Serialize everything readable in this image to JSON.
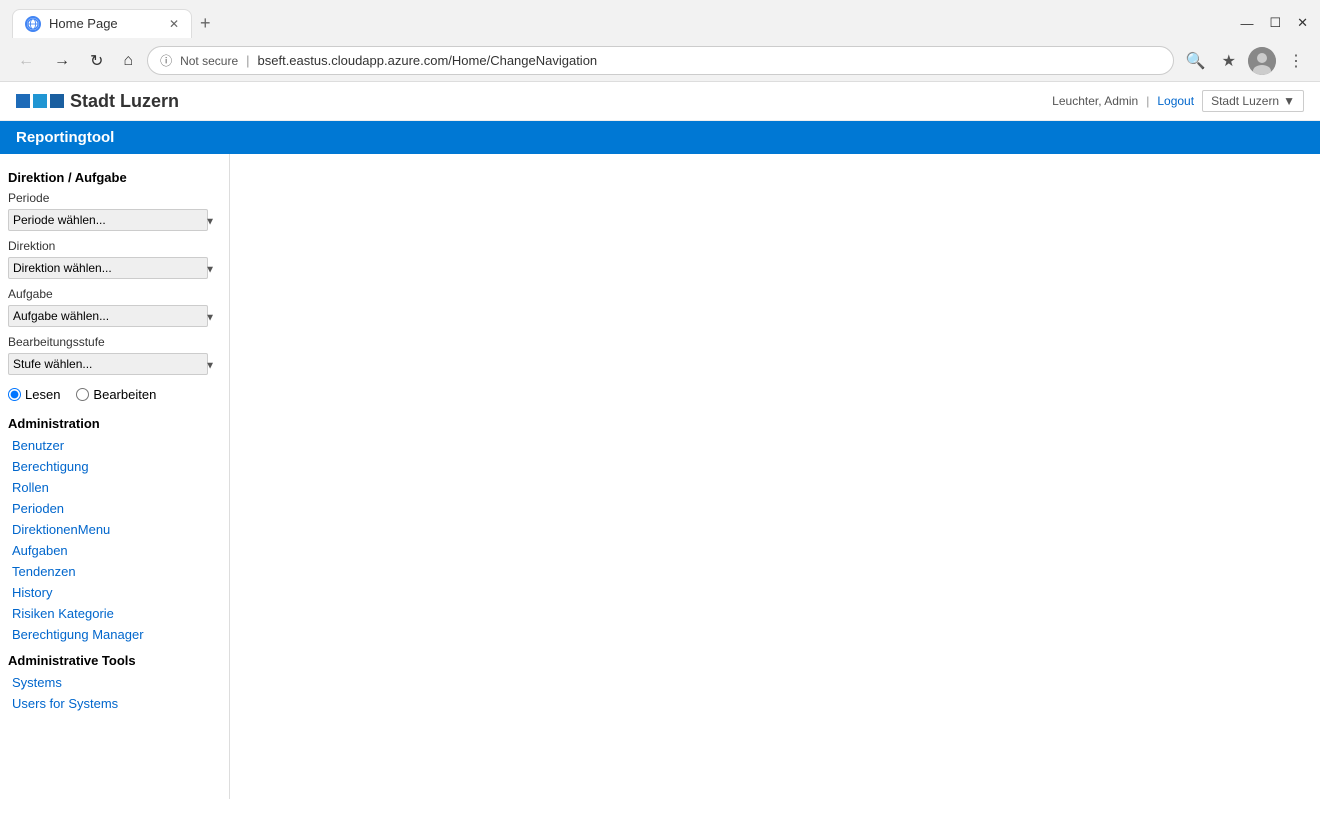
{
  "browser": {
    "tab_title": "Home Page",
    "new_tab_label": "+",
    "url_security": "Not secure",
    "url": "bseft.eastus.cloudapp.azure.com/Home/ChangeNavigation",
    "nav": {
      "back": "‹",
      "forward": "›",
      "reload": "↻",
      "home": "⌂"
    },
    "window_controls": {
      "minimize": "—",
      "maximize": "☐",
      "close": "✕"
    }
  },
  "app": {
    "org_name": "Stadt Luzern",
    "navbar_title": "Reportingtool",
    "user_info": {
      "name": "Leuchter, Admin",
      "separator": "|",
      "logout": "Logout"
    },
    "city_dropdown": "Stadt Luzern"
  },
  "sidebar": {
    "section1_title": "Direktion / Aufgabe",
    "periode_label": "Periode",
    "periode_placeholder": "Periode wählen...",
    "direktion_label": "Direktion",
    "direktion_placeholder": "Direktion wählen...",
    "aufgabe_label": "Aufgabe",
    "aufgabe_placeholder": "Aufgabe wählen...",
    "bearbeitungsstufe_label": "Bearbeitungsstufe",
    "bearbeitungsstufe_placeholder": "Stufe wählen...",
    "radio_lesen": "Lesen",
    "radio_bearbeiten": "Bearbeiten",
    "admin_title": "Administration",
    "admin_links": [
      "Benutzer",
      "Berechtigung",
      "Rollen",
      "Perioden",
      "DirektionenMenu",
      "Aufgaben",
      "Tendenzen",
      "History",
      "Risiken Kategorie",
      "Berechtigung Manager"
    ],
    "admin_tools_title": "Administrative Tools",
    "admin_tools_links": [
      "Systems",
      "Users for Systems"
    ]
  }
}
